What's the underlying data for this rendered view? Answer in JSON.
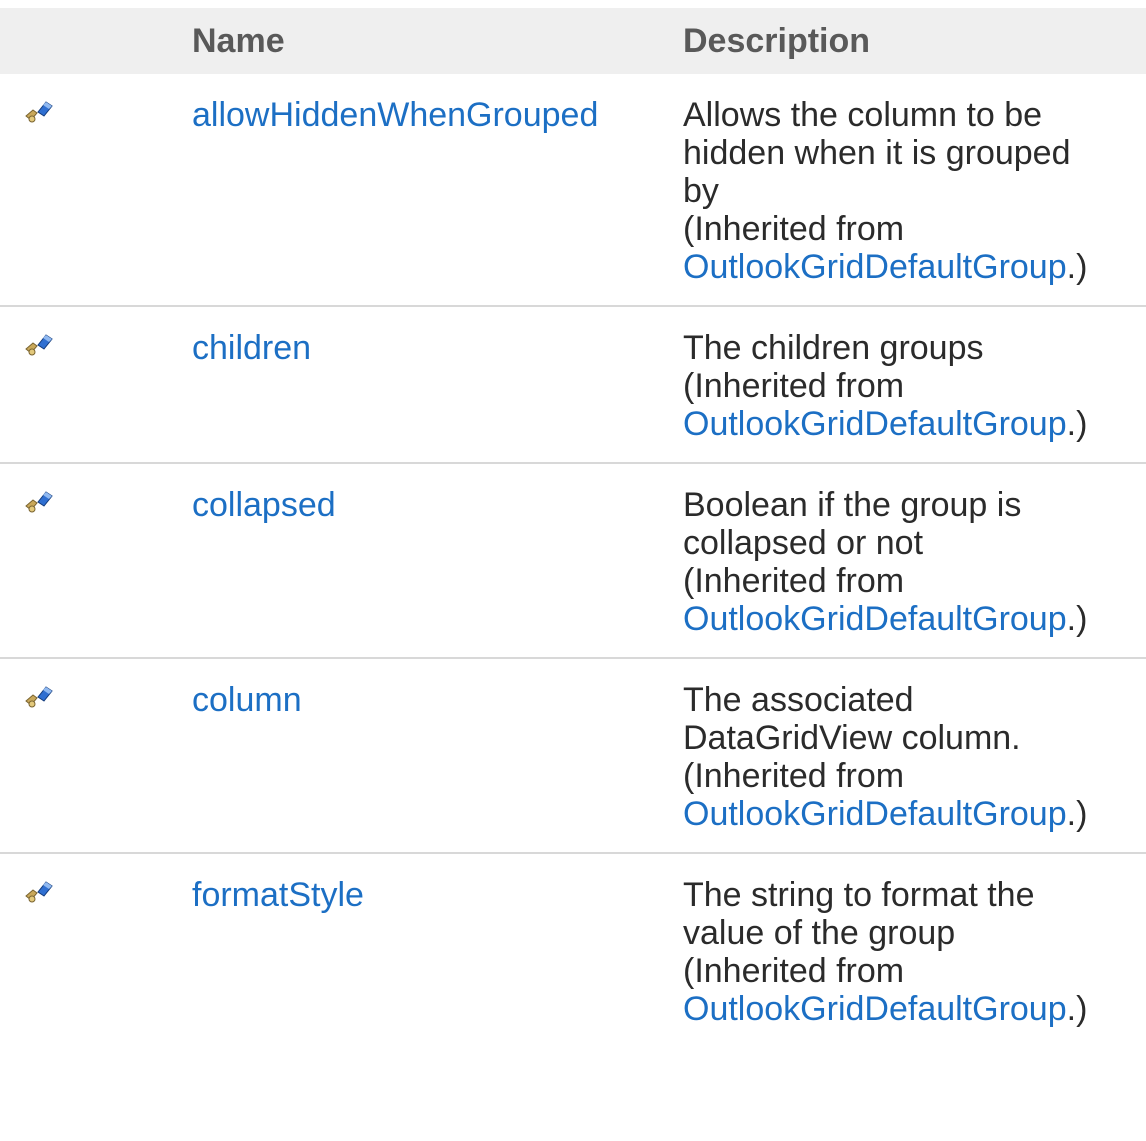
{
  "table": {
    "headers": {
      "icon": "",
      "name": "Name",
      "description": "Description"
    },
    "rows": [
      {
        "icon": "public-property-icon",
        "name": "allowHiddenWhenGrouped",
        "description_lines": [
          "Allows the column to be",
          "hidden when it is grouped",
          "by"
        ],
        "inherited_prefix": "(Inherited from",
        "inherited_link": "OutlookGridDefaultGroup",
        "inherited_suffix": ".)"
      },
      {
        "icon": "public-property-icon",
        "name": "children",
        "description_lines": [
          "The children groups"
        ],
        "inherited_prefix": "(Inherited from",
        "inherited_link": "OutlookGridDefaultGroup",
        "inherited_suffix": ".)"
      },
      {
        "icon": "public-property-icon",
        "name": "collapsed",
        "description_lines": [
          "Boolean if the group is",
          "collapsed or not"
        ],
        "inherited_prefix": "(Inherited from",
        "inherited_link": "OutlookGridDefaultGroup",
        "inherited_suffix": ".)"
      },
      {
        "icon": "public-property-icon",
        "name": "column",
        "description_lines": [
          "The associated",
          "DataGridView column."
        ],
        "inherited_prefix": "(Inherited from",
        "inherited_link": "OutlookGridDefaultGroup",
        "inherited_suffix": ".)"
      },
      {
        "icon": "public-property-icon",
        "name": "formatStyle",
        "description_lines": [
          "The string to format the",
          "value of the group"
        ],
        "inherited_prefix": "(Inherited from",
        "inherited_link": "OutlookGridDefaultGroup",
        "inherited_suffix": ".)"
      }
    ]
  },
  "colors": {
    "link": "#1c6fc4",
    "header_bg": "#efefef",
    "header_text": "#595959",
    "row_divider": "#d8d8d8"
  }
}
